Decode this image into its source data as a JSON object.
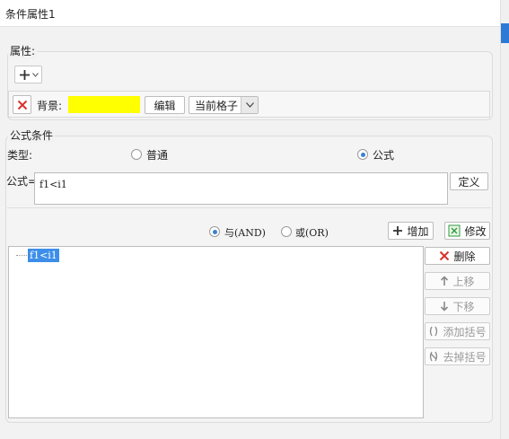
{
  "window": {
    "title": "条件属性1"
  },
  "attributes": {
    "group_title": "属性:",
    "add_icon": "plus-icon",
    "delete_icon": "x-icon",
    "background_label": "背景:",
    "background_color": "#ffff00",
    "edit_button": "编辑",
    "scope_select": "当前格子"
  },
  "formula": {
    "group_title": "公式条件",
    "type_label": "类型:",
    "options": [
      "普通",
      "公式"
    ],
    "selected_option": "公式",
    "formula_label": "公式=",
    "formula_value": "f1<i1",
    "define_button": "定义"
  },
  "logic": {
    "and_label": "与(AND)",
    "or_label": "或(OR)",
    "selected": "与(AND)",
    "add_button": "增加",
    "modify_button": "修改"
  },
  "condition_tree": {
    "items": [
      "f1<i1"
    ]
  },
  "side_buttons": {
    "delete": "删除",
    "move_up": "上移",
    "move_down": "下移",
    "add_bracket": "添加括号",
    "remove_bracket": "去掉括号"
  },
  "colors": {
    "accent": "#3b7fd3",
    "selection": "#3d8ee8",
    "delete_red": "#d8322b",
    "modify_green": "#2e9a3a"
  }
}
